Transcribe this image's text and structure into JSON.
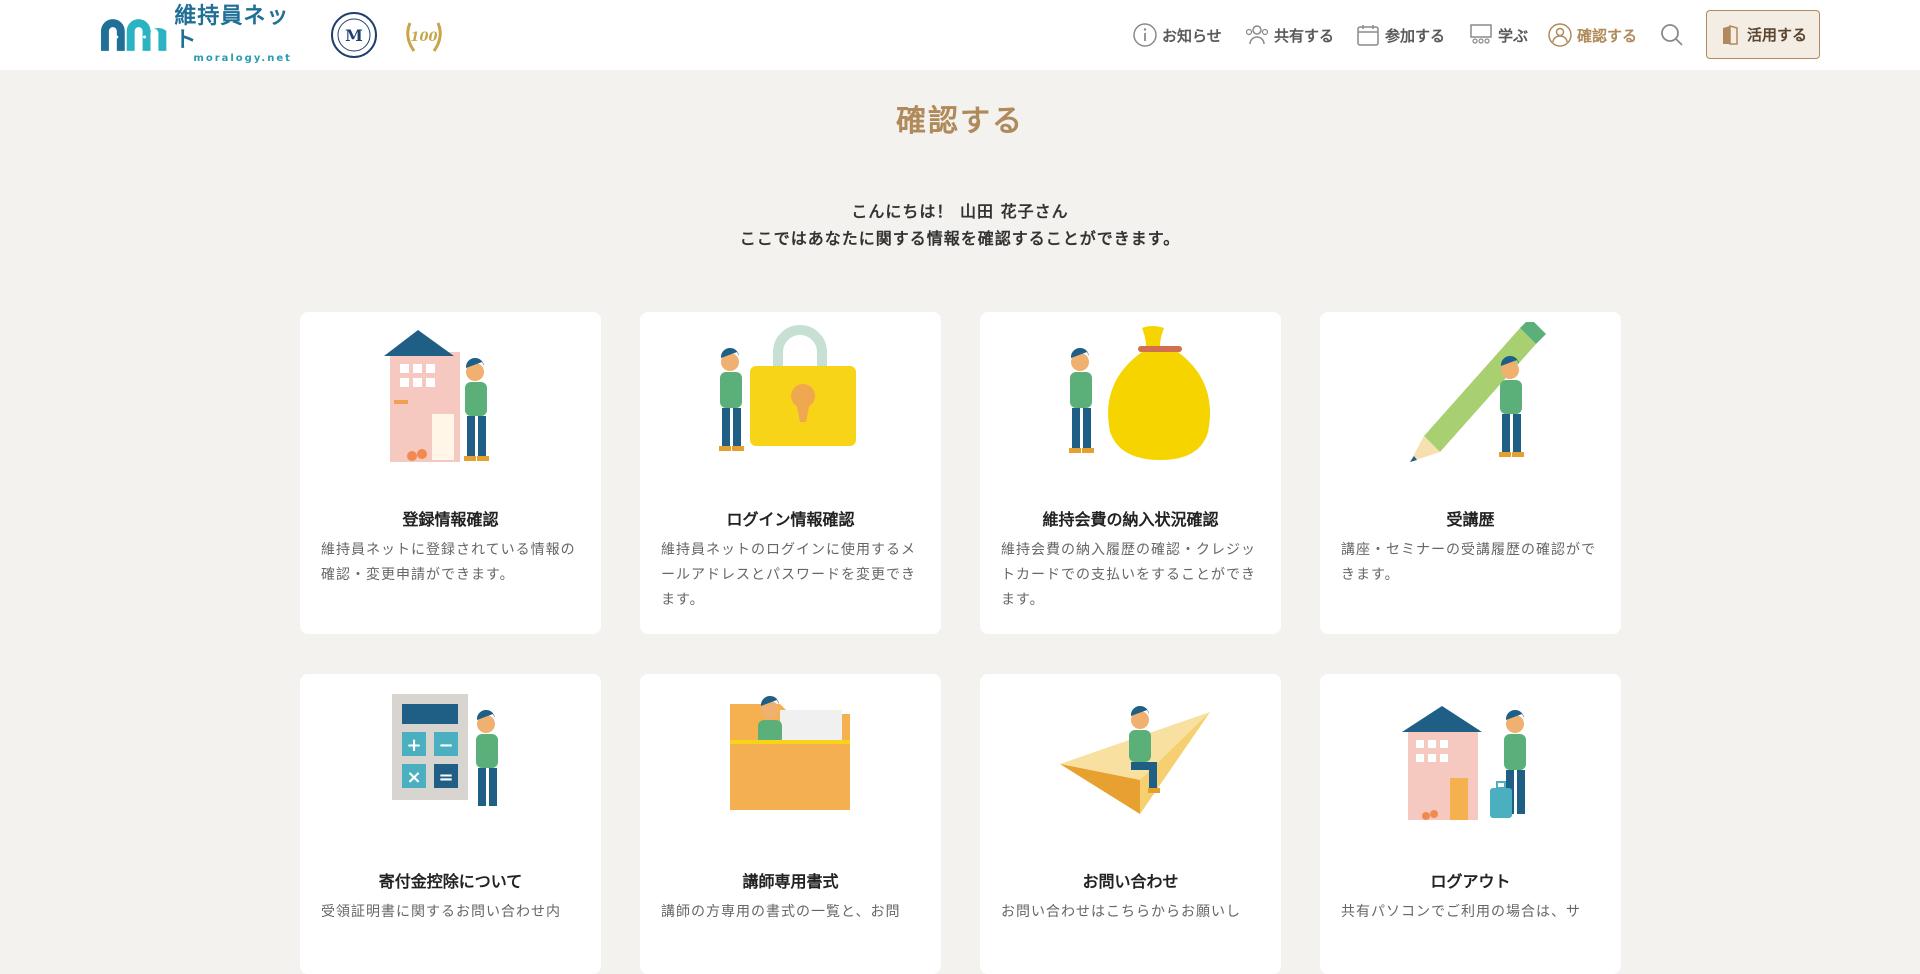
{
  "header": {
    "logo": {
      "jp": "維持員ネット",
      "en": "moralogy.net"
    },
    "nav": [
      {
        "label": "お知らせ",
        "icon": "info-icon"
      },
      {
        "label": "共有する",
        "icon": "people-icon"
      },
      {
        "label": "参加する",
        "icon": "calendar-icon"
      },
      {
        "label": "学ぶ",
        "icon": "classroom-icon"
      },
      {
        "label": "確認する",
        "icon": "user-icon",
        "active": true
      }
    ],
    "search_icon": "search-icon",
    "cta_label": "活用する",
    "cta_icon": "book-icon"
  },
  "page": {
    "title": "確認する",
    "greeting_line1": "こんにちは！ 山田 花子さん",
    "greeting_line2": "ここではあなたに関する情報を確認することができます。"
  },
  "cards": [
    {
      "title": "登録情報確認",
      "desc": "維持員ネットに登録されている情報の確認・変更申請ができます。",
      "illustration": "house-person-illustration"
    },
    {
      "title": "ログイン情報確認",
      "desc": "維持員ネットのログインに使用するメールアドレスとパスワードを変更できます。",
      "illustration": "padlock-illustration"
    },
    {
      "title": "維持会費の納入状況確認",
      "desc": "維持会費の納入履歴の確認・クレジットカードでの支払いをすることができます。",
      "illustration": "money-bag-illustration"
    },
    {
      "title": "受講歴",
      "desc": "講座・セミナーの受講履歴の確認ができます。",
      "illustration": "pencil-illustration"
    },
    {
      "title": "寄付金控除について",
      "desc": "受領証明書に関するお問い合わせ内",
      "illustration": "calculator-illustration"
    },
    {
      "title": "講師専用書式",
      "desc": "講師の方専用の書式の一覧と、お問",
      "illustration": "folder-illustration"
    },
    {
      "title": "お問い合わせ",
      "desc": "お問い合わせはこちらからお願いし",
      "illustration": "paper-plane-illustration"
    },
    {
      "title": "ログアウト",
      "desc": "共有パソコンでご利用の場合は、サ",
      "illustration": "house-suitcase-illustration"
    }
  ],
  "colors": {
    "accent": "#b08a5a",
    "background": "#f3f2ef",
    "teal": "#1f6f96"
  }
}
